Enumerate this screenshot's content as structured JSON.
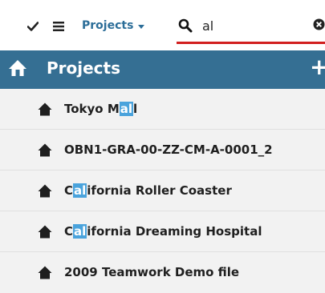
{
  "toolbar": {
    "project_select_label": "Projects",
    "search_value": "al",
    "search_accent_color": "#d21f1f"
  },
  "header": {
    "title": "Projects",
    "add_label": "+",
    "background_color": "#356f93"
  },
  "results": [
    {
      "prefix": "Tokyo M",
      "match": "al",
      "suffix": "l"
    },
    {
      "prefix": "OBN1-GRA-00-ZZ-CM-A-0001_2",
      "match": "",
      "suffix": ""
    },
    {
      "prefix": "C",
      "match": "al",
      "suffix": "ifornia Roller Coaster"
    },
    {
      "prefix": "C",
      "match": "al",
      "suffix": "ifornia Dreaming Hospital"
    },
    {
      "prefix": "2009 Teamwork Demo file",
      "match": "",
      "suffix": ""
    }
  ],
  "icons": {
    "toolbar": [
      "checkmark-icon",
      "menu-icon",
      "search-icon",
      "clear-icon"
    ],
    "header": "home-icon",
    "list": "home-icon"
  },
  "highlight_color": "#4aa3dc"
}
